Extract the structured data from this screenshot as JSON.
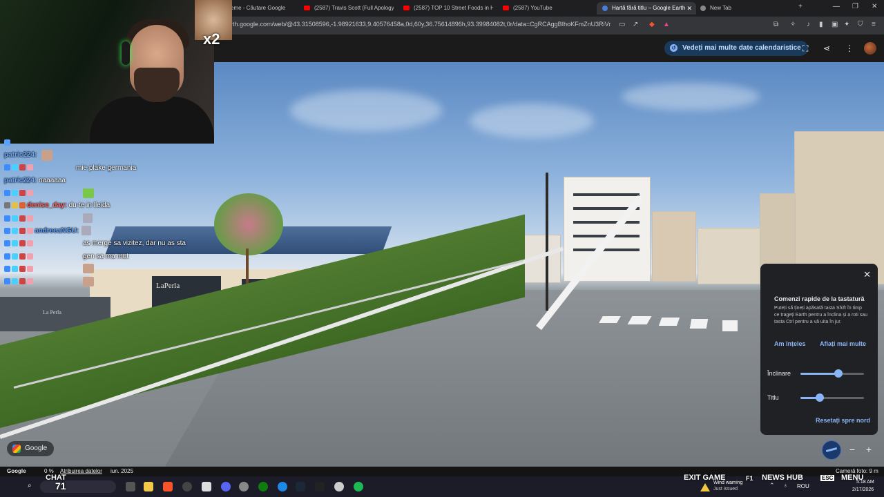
{
  "browser": {
    "tabs": [
      {
        "label": "eme - Căutare Google",
        "active": false
      },
      {
        "label": "(2587) Travis Scott (Full Apology)",
        "active": false
      },
      {
        "label": "(2587) TOP 10 Street Foods in HA",
        "active": false
      },
      {
        "label": "(2587) YouTube",
        "active": false
      },
      {
        "label": "Hartă fără titlu – Google Earth",
        "active": true
      },
      {
        "label": "New Tab",
        "active": false
      }
    ],
    "url": "rth.google.com/web/@43.31508596,-1.98921633,9.40576458a,0d,60y,36.75614896h,93.39984082t,0r/data=CgRCAggBIhoKFmZnU3RiVnBFeF..."
  },
  "earth": {
    "history_button": "Vedeți mai multe date calendaristice",
    "google_pill": "Google",
    "controls": {
      "title": "Comenzi rapide de la tastatură",
      "description": "Puteți să țineți apăsată tasta Shift în timp ce trageți Earth pentru a înclina și a roti sau tasta Ctrl pentru a vă uita în jur.",
      "got_it": "Am înțeles",
      "learn_more": "Aflați mai multe",
      "tilt_label": "Înclinare",
      "tilt_value": 0.6,
      "heading_label": "Titlu",
      "heading_value": 0.3,
      "reset": "Resetați spre nord"
    },
    "status": {
      "brand": "Google",
      "percent": "0 %",
      "attribution": "Atribuirea datelor",
      "date": "iun. 2025",
      "camera": "Cameră foto: 9 m"
    }
  },
  "stream": {
    "multiplier": "x2",
    "chat": [
      {
        "user": "",
        "text": "",
        "color": "#5aa0ff"
      },
      {
        "user": "patric224:",
        "text": "",
        "color": "#6aa8ff"
      },
      {
        "user": "",
        "text": "mie plake germania",
        "color": "#5aa0ff"
      },
      {
        "user": "patric224:",
        "text": "naaaaaa",
        "color": "#6aa8ff"
      },
      {
        "user": "",
        "text": "",
        "color": "#5aa0ff"
      },
      {
        "user": "denise_day:",
        "text": "du-te in lleida",
        "color": "#ff6a6a"
      },
      {
        "user": "",
        "text": "",
        "color": "#5aa0ff"
      },
      {
        "user": "andreeaNGU:",
        "text": "",
        "color": "#5aa0ff"
      },
      {
        "user": "",
        "text": "as merge sa vizitez, dar nu as sta",
        "color": "#5aa0ff"
      },
      {
        "user": "",
        "text": "gen sa ma mut",
        "color": "#5aa0ff"
      },
      {
        "user": "",
        "text": "",
        "color": "#5aa0ff"
      },
      {
        "user": "",
        "text": "",
        "color": "#5aa0ff"
      }
    ]
  },
  "scene": {
    "sign_la_perla": "LaPerla",
    "sign_la_perla_small": "La Perla"
  },
  "overlay": {
    "exit_game": "EXIT GAME",
    "f1": "F1",
    "news_hub": "NEWS HUB",
    "esc": "ESC",
    "menu": "MENU",
    "chat_label": "CHAT",
    "score": "71",
    "weather_title": "Wind warning",
    "weather_sub": "Just issued",
    "lang": "ROU",
    "time": "5:18 AM",
    "date": "2/17/2026"
  }
}
